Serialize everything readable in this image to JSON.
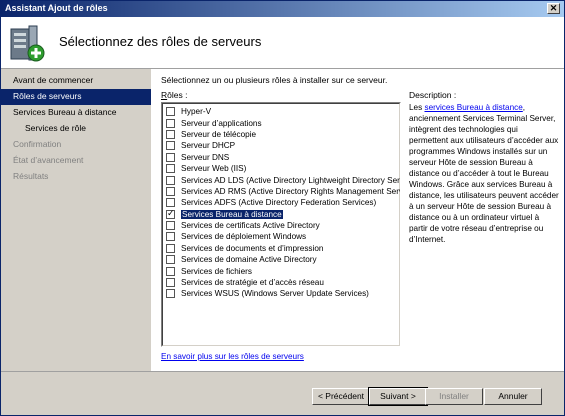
{
  "window": {
    "title": "Assistant Ajout de rôles",
    "close_glyph": "✕"
  },
  "header": {
    "title": "Sélectionnez des rôles de serveurs",
    "icon": "server-add-icon"
  },
  "sidebar": {
    "items": [
      {
        "label": "Avant de commencer",
        "state": "normal",
        "level": 0
      },
      {
        "label": "Rôles de serveurs",
        "state": "active",
        "level": 0
      },
      {
        "label": "Services Bureau à distance",
        "state": "normal",
        "level": 0
      },
      {
        "label": "Services de rôle",
        "state": "normal",
        "level": 1
      },
      {
        "label": "Confirmation",
        "state": "disabled",
        "level": 0
      },
      {
        "label": "État d’avancement",
        "state": "disabled",
        "level": 0
      },
      {
        "label": "Résultats",
        "state": "disabled",
        "level": 0
      }
    ]
  },
  "main": {
    "intro": "Sélectionnez un ou plusieurs rôles à installer sur ce serveur.",
    "roles_label_prefix": "R",
    "roles_label_rest": "ôles :",
    "roles": [
      {
        "label": "Hyper-V",
        "checked": false
      },
      {
        "label": "Serveur d’applications",
        "checked": false
      },
      {
        "label": "Serveur de télécopie",
        "checked": false
      },
      {
        "label": "Serveur DHCP",
        "checked": false
      },
      {
        "label": "Serveur DNS",
        "checked": false
      },
      {
        "label": "Serveur Web (IIS)",
        "checked": false
      },
      {
        "label": "Services AD LDS (Active Directory Lightweight Directory Services",
        "checked": false
      },
      {
        "label": "Services AD RMS (Active Directory Rights Management Services)",
        "checked": false
      },
      {
        "label": "Services ADFS (Active Directory Federation Services)",
        "checked": false
      },
      {
        "label": "Services Bureau à distance",
        "checked": true,
        "selected": true
      },
      {
        "label": "Services de certificats Active Directory",
        "checked": false
      },
      {
        "label": "Services de déploiement Windows",
        "checked": false
      },
      {
        "label": "Services de documents et d’impression",
        "checked": false
      },
      {
        "label": "Services de domaine Active Directory",
        "checked": false
      },
      {
        "label": "Services de fichiers",
        "checked": false
      },
      {
        "label": "Services de stratégie et d’accès réseau",
        "checked": false
      },
      {
        "label": "Services WSUS (Windows Server Update Services)",
        "checked": false
      }
    ],
    "description_title": "Description :",
    "description_prefix": "Les ",
    "description_link": "services Bureau à distance",
    "description_body": ", anciennement Services Terminal Server, intègrent des technologies qui permettent aux utilisateurs d’accéder aux  programmes Windows installés sur un serveur Hôte de session Bureau à distance ou d’accéder à tout le Bureau Windows. Grâce aux services Bureau à distance, les utilisateurs peuvent accéder à un serveur Hôte de session Bureau à distance ou à un ordinateur virtuel à partir de votre réseau d’entreprise ou d’Internet.",
    "more_link": "En savoir plus sur les rôles de serveurs"
  },
  "footer": {
    "prev_label": "< Précédent",
    "next_label": "Suivant >",
    "install_label": "Installer",
    "cancel_label": "Annuler"
  }
}
